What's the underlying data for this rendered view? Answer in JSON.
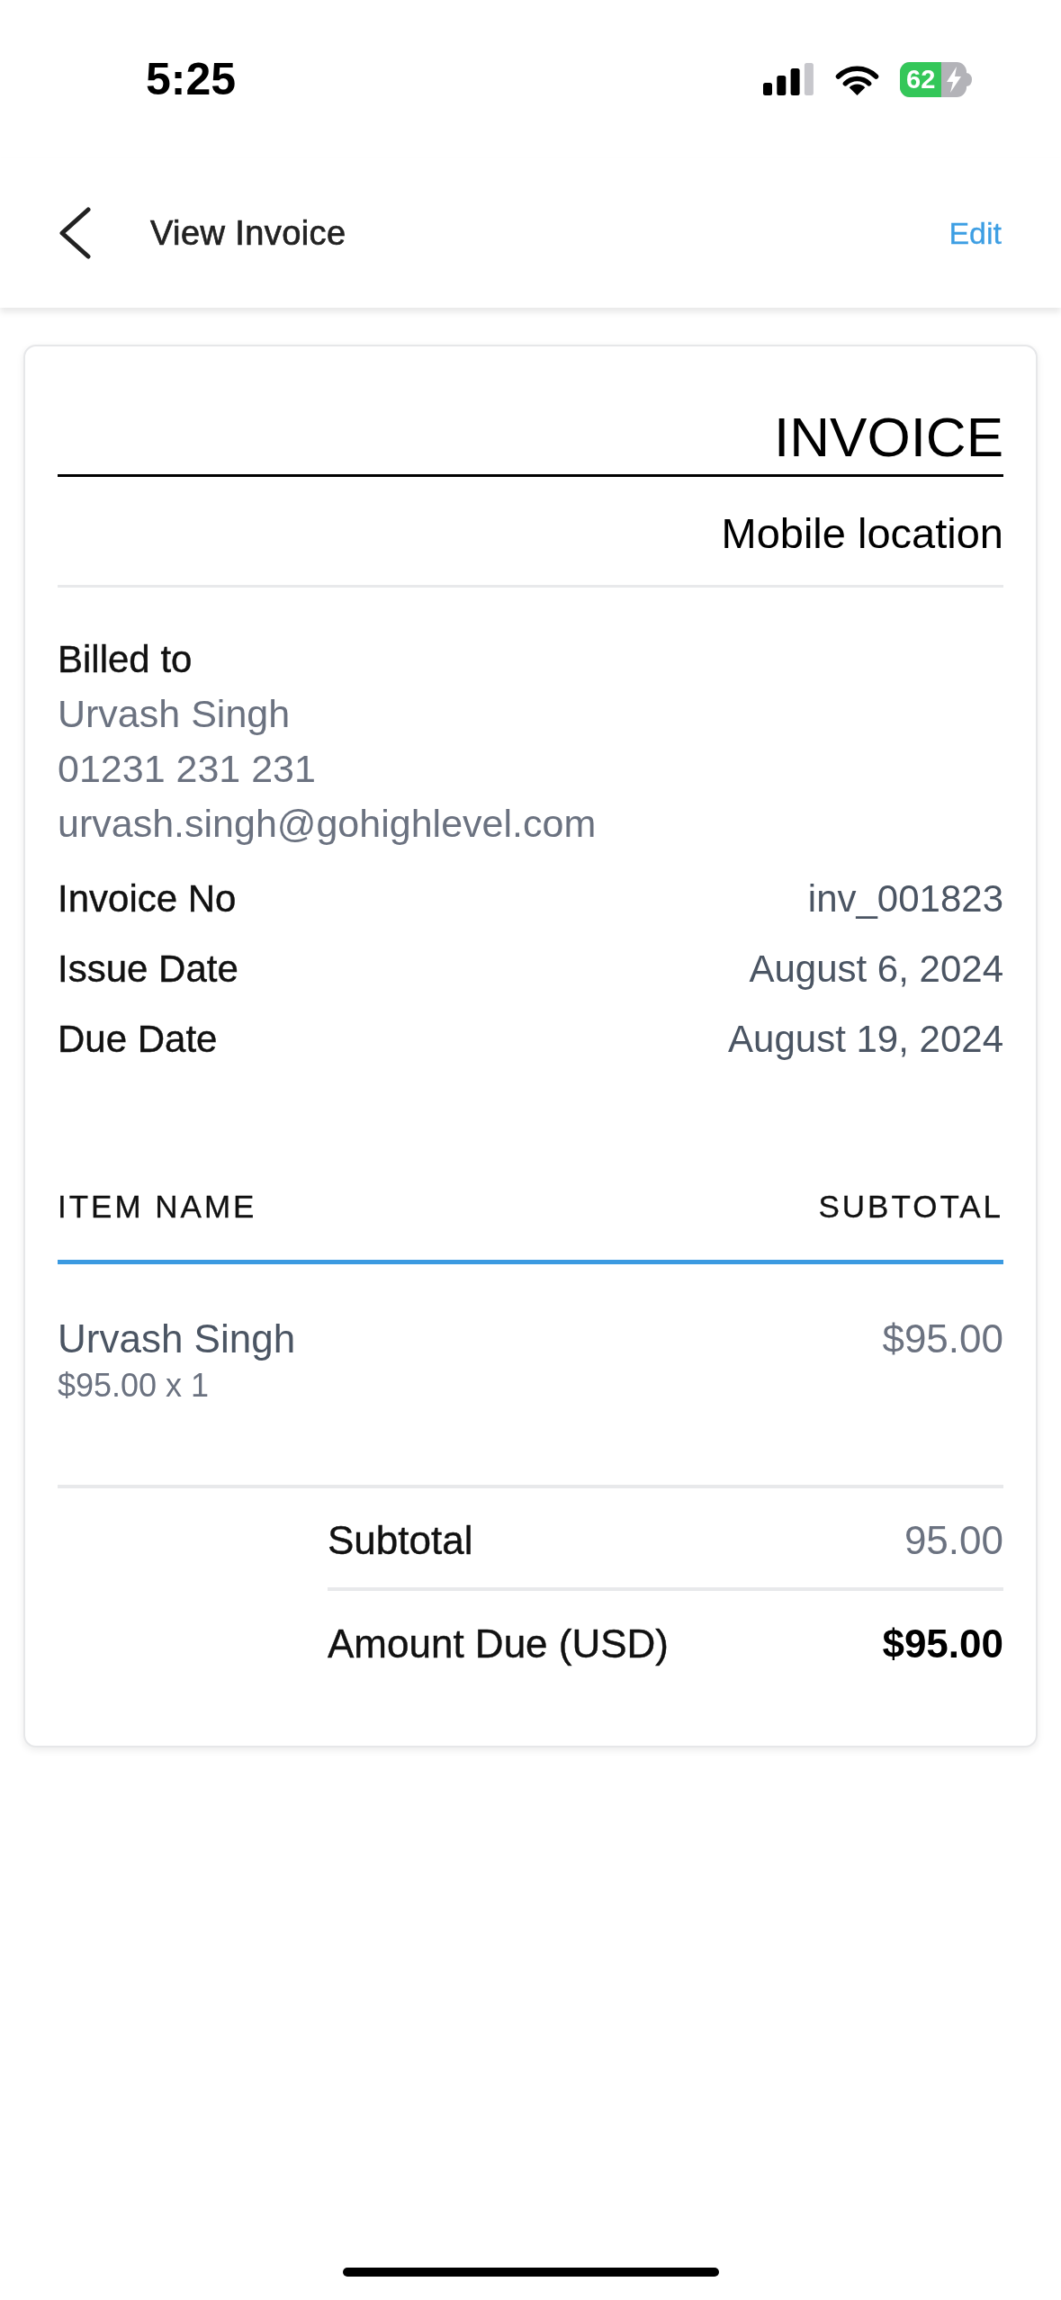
{
  "status_bar": {
    "time": "5:25",
    "battery": "62",
    "charging": true
  },
  "header": {
    "title": "View Invoice",
    "action": "Edit"
  },
  "invoice": {
    "title": "INVOICE",
    "business_name": "Mobile location",
    "billed_to": {
      "label": "Billed to",
      "name": "Urvash Singh",
      "phone": "01231 231 231",
      "email": "urvash.singh@gohighlevel.com"
    },
    "details": [
      {
        "label": "Invoice No",
        "value": "inv_001823"
      },
      {
        "label": "Issue Date",
        "value": "August 6, 2024"
      },
      {
        "label": "Due Date",
        "value": "August 19, 2024"
      }
    ],
    "items": {
      "columns": [
        "ITEM NAME",
        "SUBTOTAL"
      ],
      "rows": [
        {
          "name": "Urvash Singh",
          "price_quantity": "$95.00 x 1",
          "subtotal": "$95.00"
        }
      ]
    },
    "totals": [
      {
        "kind": "subtotal",
        "label": "Subtotal",
        "value": "95.00"
      },
      {
        "kind": "amount_due",
        "label": "Amount Due (USD)",
        "value": "$95.00"
      }
    ]
  }
}
